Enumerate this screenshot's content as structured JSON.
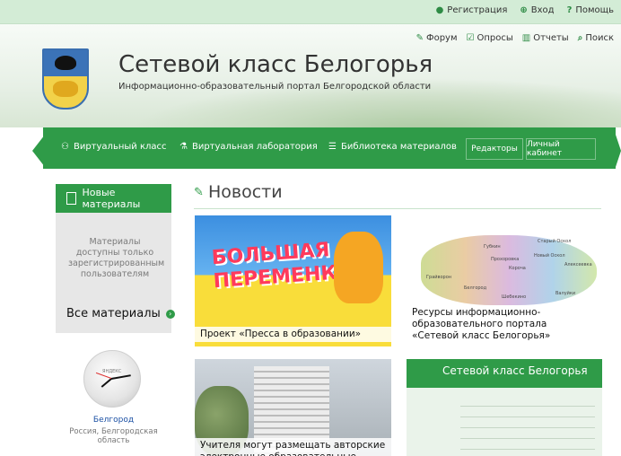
{
  "topbar": {
    "register": "Регистрация",
    "login": "Вход",
    "help": "Помощь"
  },
  "header": {
    "forum": "Форум",
    "polls": "Опросы",
    "reports": "Отчеты",
    "search": "Поиск",
    "title": "Сетевой класс Белогорья",
    "subtitle": "Информационно-образовательный портал Белгородской области"
  },
  "nav": {
    "virtual_class": "Виртуальный класс",
    "virtual_lab": "Виртуальная лаборатория",
    "library": "Библиотека материалов",
    "editors": "Редакторы",
    "cabinet": "Личный кабинет"
  },
  "sidebar": {
    "new_materials": "Новые материалы",
    "note": "Материалы доступны только зарегистрированным пользователям",
    "all_materials": "Все материалы"
  },
  "clock": {
    "city": "Белгород",
    "region": "Россия, Белгородская область",
    "brand": "ЯНДЕКС"
  },
  "news": {
    "title": "Новости",
    "cards": [
      {
        "caption": "Проект «Пресса в образовании»",
        "image_text": "БОЛЬШАЯ ПЕРЕМЕНКА"
      },
      {
        "caption": "Ресурсы информационно-образовательного портала «Сетевой класс Белогорья»"
      },
      {
        "caption": "Учителя могут размещать авторские электронные образовательные"
      },
      {
        "caption": ""
      }
    ],
    "card4_title": "Сетевой класс Белогорья"
  },
  "map_labels": [
    "Губкин",
    "Старый Оскол",
    "Белгород",
    "Валуйки",
    "Алексеевка",
    "Короча",
    "Грайворон",
    "Новый Оскол",
    "Прохоровка",
    "Шебекино"
  ]
}
